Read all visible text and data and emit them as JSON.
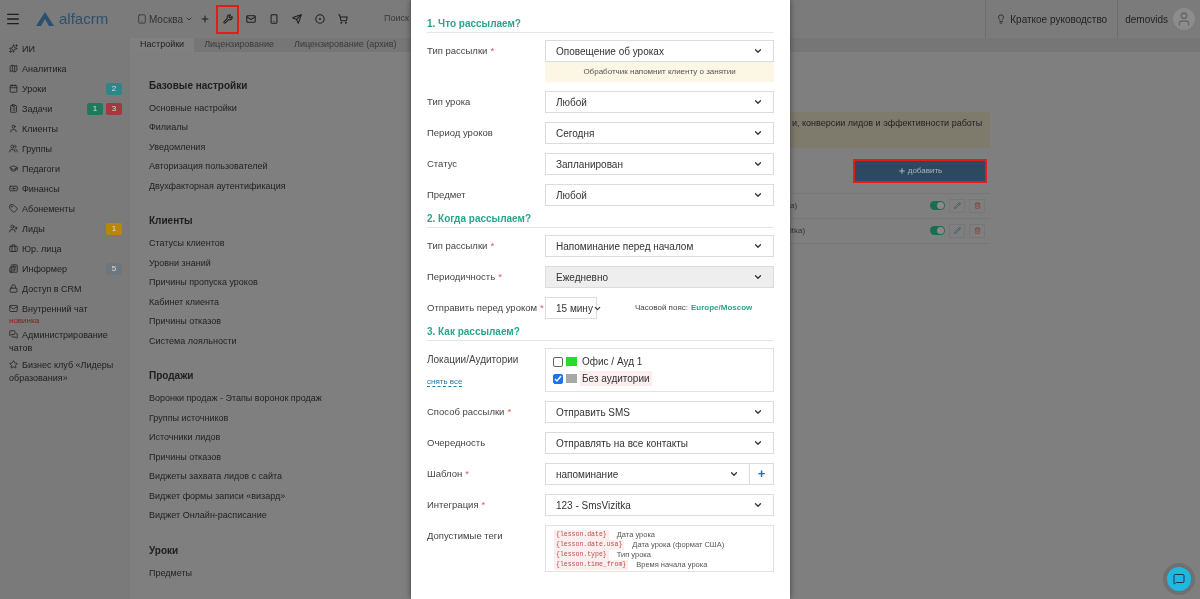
{
  "topbar": {
    "logo": "alfacrm",
    "branch": "Москва",
    "tools": [
      {
        "highlighted": false
      },
      {
        "highlighted": true
      },
      {
        "highlighted": false
      },
      {
        "highlighted": false
      },
      {
        "highlighted": false
      },
      {
        "highlighted": false
      },
      {
        "highlighted": false
      }
    ],
    "search": {
      "placeholder": "Поиск"
    },
    "guide": "Краткое руководство",
    "user": "demovids"
  },
  "sidebar": {
    "items": [
      {
        "label": "ИИ"
      },
      {
        "label": "Аналитика"
      },
      {
        "label": "Уроки",
        "badges": [
          {
            "text": "2",
            "color": "#2a8888"
          }
        ]
      },
      {
        "label": "Задачи",
        "badges": [
          {
            "text": "1",
            "color": "#1e7a5c"
          },
          {
            "text": "3",
            "color": "#a03a3e"
          }
        ]
      },
      {
        "label": "Клиенты"
      },
      {
        "label": "Группы"
      },
      {
        "label": "Педагоги"
      },
      {
        "label": "Финансы"
      },
      {
        "label": "Абонементы"
      },
      {
        "label": "Лиды",
        "badges": [
          {
            "text": "1",
            "color": "#b8860b"
          }
        ]
      },
      {
        "label": "Юр. лица"
      },
      {
        "label": "Информер",
        "badges": [
          {
            "text": "5",
            "color": "#6c767c"
          }
        ]
      },
      {
        "label": "Доступ в CRM"
      },
      {
        "label": "Внутренний чат",
        "tag": "новинка"
      },
      {
        "label": "Администрирование чатов"
      },
      {
        "label": "Бизнес клуб «Лидеры образования»"
      }
    ]
  },
  "tabs": [
    {
      "label": "Настройки",
      "selected": true
    },
    {
      "label": "Лицензирование",
      "selected": false
    },
    {
      "label": "Лицензирование (архив)",
      "selected": false
    }
  ],
  "settings": {
    "groups": [
      {
        "title": "Базовые настройки",
        "items": [
          "Основные настройки",
          "Филиалы",
          "Уведомления",
          "Авторизация пользователей",
          "Двухфакторная аутентификация"
        ]
      },
      {
        "title": "Клиенты",
        "items": [
          "Статусы клиентов",
          "Уровни знаний",
          "Причины пропуска уроков",
          "Кабинет клиента",
          "Причины отказов",
          "Система лояльности"
        ]
      },
      {
        "title": "Продажи",
        "items": [
          "Воронки продаж - Этапы воронок продаж",
          "Группы источников",
          "Источники лидов",
          "Причины отказов",
          "Виджеты захвата лидов с сайта",
          "Виджет формы записи «визард»",
          "Виджет Онлайн-расписание"
        ]
      },
      {
        "title": "Уроки",
        "items": [
          "Предметы"
        ]
      }
    ]
  },
  "background_panel": {
    "notice": "и, конверсии лидов и эффективности работы",
    "add_button": {
      "label": "добавить",
      "highlighted": true
    },
    "rows": [
      {
        "text": "а)",
        "on": true
      },
      {
        "text": "itka)",
        "on": true
      }
    ]
  },
  "modal": {
    "sections": [
      {
        "title": "1. Что рассылаем?",
        "fields": [
          {
            "kind": "select",
            "label": "Тип рассылки",
            "required_mark": "*",
            "value": "Оповещение об уроках",
            "hint": "Обработчик напомнит клиенту о занятии"
          },
          {
            "kind": "select",
            "label": "Тип урока",
            "value": "Любой"
          },
          {
            "kind": "select",
            "label": "Период уроков",
            "value": "Сегодня"
          },
          {
            "kind": "select",
            "label": "Статус",
            "value": "Запланирован"
          },
          {
            "kind": "select",
            "label": "Предмет",
            "value": "Любой"
          }
        ]
      },
      {
        "title": "2. Когда рассылаем?",
        "fields": [
          {
            "kind": "select",
            "label": "Тип рассылки",
            "required_mark": "*",
            "value": "Напоминание перед началом"
          },
          {
            "kind": "select",
            "label": "Периодичность",
            "required_mark": "*",
            "value": "Ежедневно",
            "disabled": true
          },
          {
            "kind": "small_select",
            "label": "Отправить перед уроком",
            "required_mark": "*",
            "value": "15 мину",
            "note": "Часовой пояс:",
            "link": "Europe/Moscow"
          }
        ]
      },
      {
        "title": "3. Как рассылаем?",
        "fields": [
          {
            "kind": "checklist",
            "label": "Локации/Аудитории",
            "action": "снять все",
            "options": [
              {
                "label": "Офис / Ауд 1",
                "color": "#22dd22",
                "checked": false
              },
              {
                "label": "Без аудитории",
                "color": "#a8a8a8",
                "checked": true
              }
            ]
          },
          {
            "kind": "select",
            "label": "Способ рассылки",
            "required_mark": "*",
            "value": "Отправить SMS"
          },
          {
            "kind": "select",
            "label": "Очередность",
            "value": "Отправлять на все контакты"
          },
          {
            "kind": "select_add",
            "label": "Шаблон",
            "required_mark": "*",
            "value": "напоминание",
            "button": "+"
          },
          {
            "kind": "select",
            "label": "Интеграция",
            "required_mark": "*",
            "value": "123 - SmsVizitka"
          },
          {
            "kind": "tags",
            "label": "Допустимые теги",
            "tags": [
              {
                "code": "{lesson.date}",
                "text": "Дата урока"
              },
              {
                "code": "{lesson.date.usa}",
                "text": "Дата урока (формат США)"
              },
              {
                "code": "{lesson.type}",
                "text": "Тип урока"
              },
              {
                "code": "{lesson.time_from}",
                "text": "Время начала урока"
              }
            ]
          }
        ]
      }
    ]
  }
}
